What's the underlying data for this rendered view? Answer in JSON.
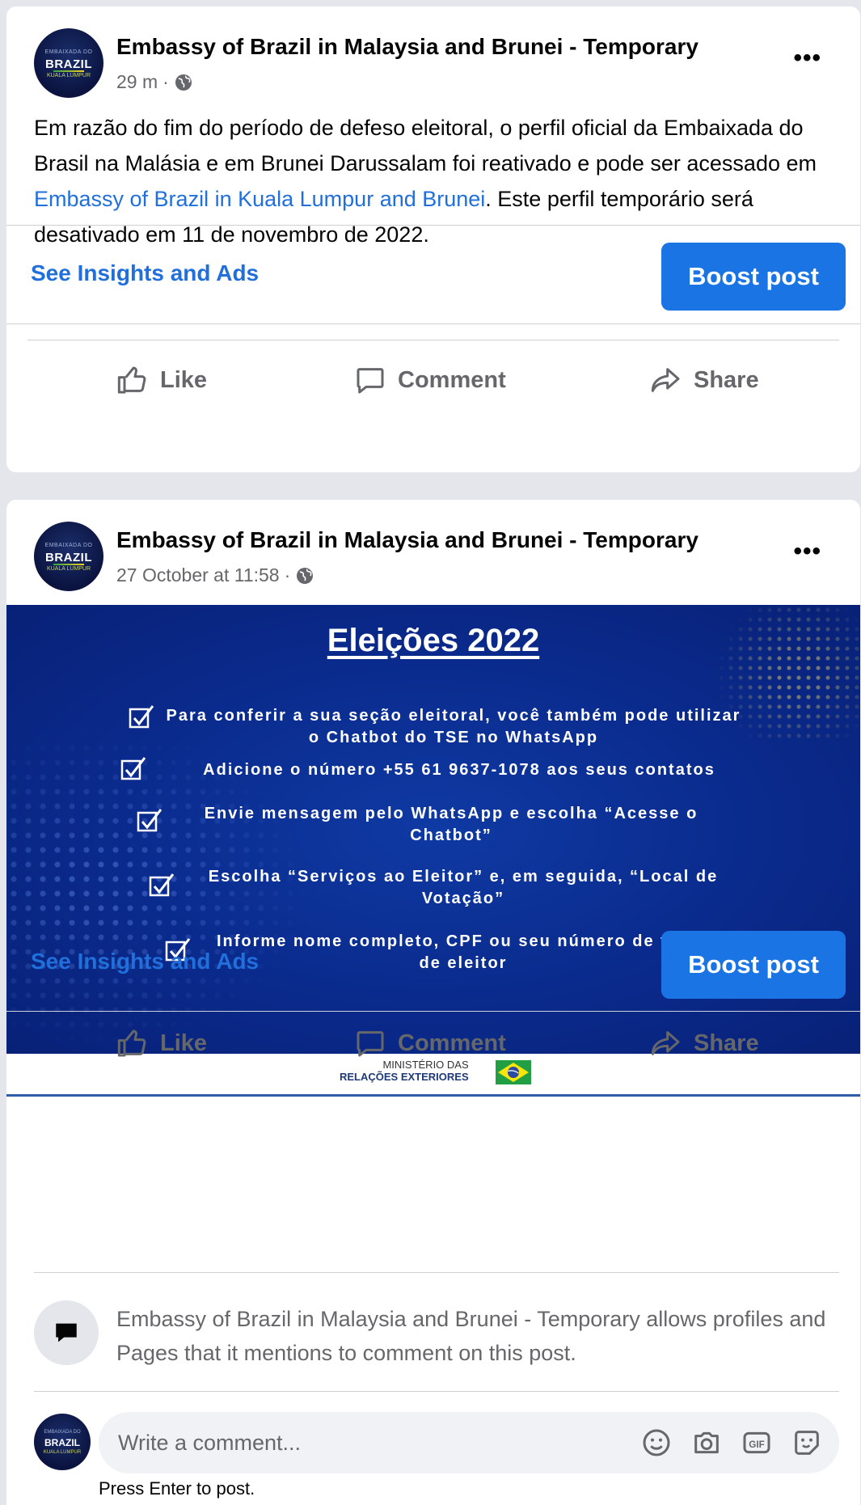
{
  "posts": [
    {
      "page_name": "Embassy of Brazil in Malaysia and Brunei - Temporary",
      "time": "29 m",
      "separator": "·",
      "text_before_link": "Em razão do fim do período de defeso eleitoral, o perfil oficial da Embaixada do Brasil na Malásia e em Brunei Darussalam foi reativado e pode ser acessado em ",
      "link_text": "Embassy of Brazil in Kuala Lumpur and Brunei",
      "text_after_link": ". Este perfil temporário será desativado em 11 de novembro de 2022.",
      "insights_label": "See Insights and Ads",
      "boost_label": "Boost post",
      "actions": {
        "like": "Like",
        "comment": "Comment",
        "share": "Share"
      }
    },
    {
      "page_name": "Embassy of Brazil in Malaysia and Brunei - Temporary",
      "time": "27 October at 11:58",
      "separator": "·",
      "insights_label": "See Insights and Ads",
      "boost_label": "Boost post",
      "actions": {
        "like": "Like",
        "comment": "Comment",
        "share": "Share"
      }
    }
  ],
  "avatar": {
    "top": "EMBAIXADA DO",
    "main": "BRAZIL",
    "bottom": "KUALA LUMPUR"
  },
  "banner": {
    "title": "Eleições 2022",
    "items": [
      "Para conferir a sua seção eleitoral, você também pode utilizar o Chatbot do TSE no WhatsApp",
      "Adicione o número +55 61 9637-1078 aos seus contatos",
      "Envie mensagem pelo WhatsApp e escolha “Acesse o Chatbot”",
      "Escolha “Serviços ao Eleitor” e, em seguida, “Local de Votação”",
      "Informe nome completo, CPF ou seu número de título de eleitor"
    ],
    "footer_line1": "MINISTÉRIO DAS",
    "footer_line2": "RELAÇÕES EXTERIORES"
  },
  "comment_notice": "Embassy of Brazil in Malaysia and Brunei - Temporary allows profiles and Pages that it mentions to comment on this post.",
  "comment_box": {
    "placeholder": "Write a comment...",
    "icons": [
      "emoji-icon",
      "camera-icon",
      "gif-icon",
      "sticker-icon"
    ]
  },
  "press_enter": "Press Enter to post.",
  "colors": {
    "accent": "#1b74e4",
    "link": "#216fdb",
    "banner_blue": "#0a2a8c"
  }
}
